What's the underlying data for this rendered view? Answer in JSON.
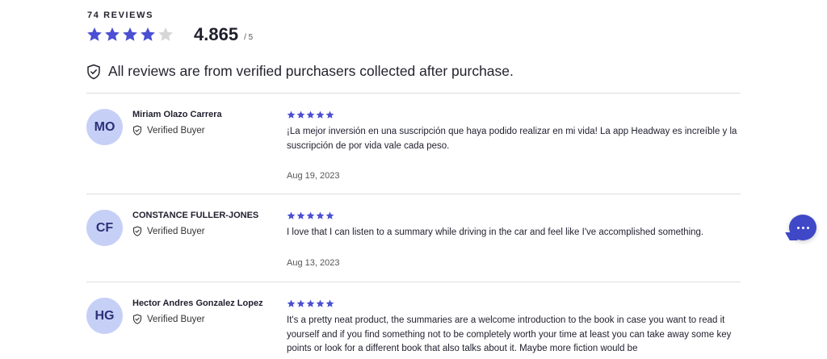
{
  "summary": {
    "review_count": "74 REVIEWS",
    "score": "4.865",
    "out_of": "/ 5",
    "stars_filled": 4,
    "stars_total": 5,
    "notice": "All reviews are from verified purchasers collected after purchase."
  },
  "colors": {
    "star": "#4b4fd3",
    "star_empty": "#d6d6d6",
    "avatar_bg": "#c6d0f7",
    "avatar_text": "#2b3178",
    "chat": "#3f48c7"
  },
  "reviews": [
    {
      "initials": "MO",
      "name": "Miriam Olazo Carrera",
      "verified": "Verified Buyer",
      "stars": 5,
      "body": "¡La mejor inversión en una suscripción que haya podido realizar en mi vida! La app Headway es increíble y la suscripción de por vida vale cada peso.",
      "date": "Aug 19, 2023"
    },
    {
      "initials": "CF",
      "name": "CONSTANCE FULLER-JONES",
      "verified": "Verified Buyer",
      "stars": 5,
      "body": "I love that I can listen to a summary while driving in the car and feel like I've accomplished something.",
      "date": "Aug 13, 2023"
    },
    {
      "initials": "HG",
      "name": "Hector Andres Gonzalez Lopez",
      "verified": "Verified Buyer",
      "stars": 5,
      "body": "It's a pretty neat product, the summaries are a welcome introduction to the book in case you want to read it yourself and if you find something not to be completely worth your time at least you can take away some key points or look for a different book that also talks about it. Maybe more fiction would be",
      "date": ""
    }
  ],
  "chat_button": {
    "icon": "chat-icon"
  }
}
